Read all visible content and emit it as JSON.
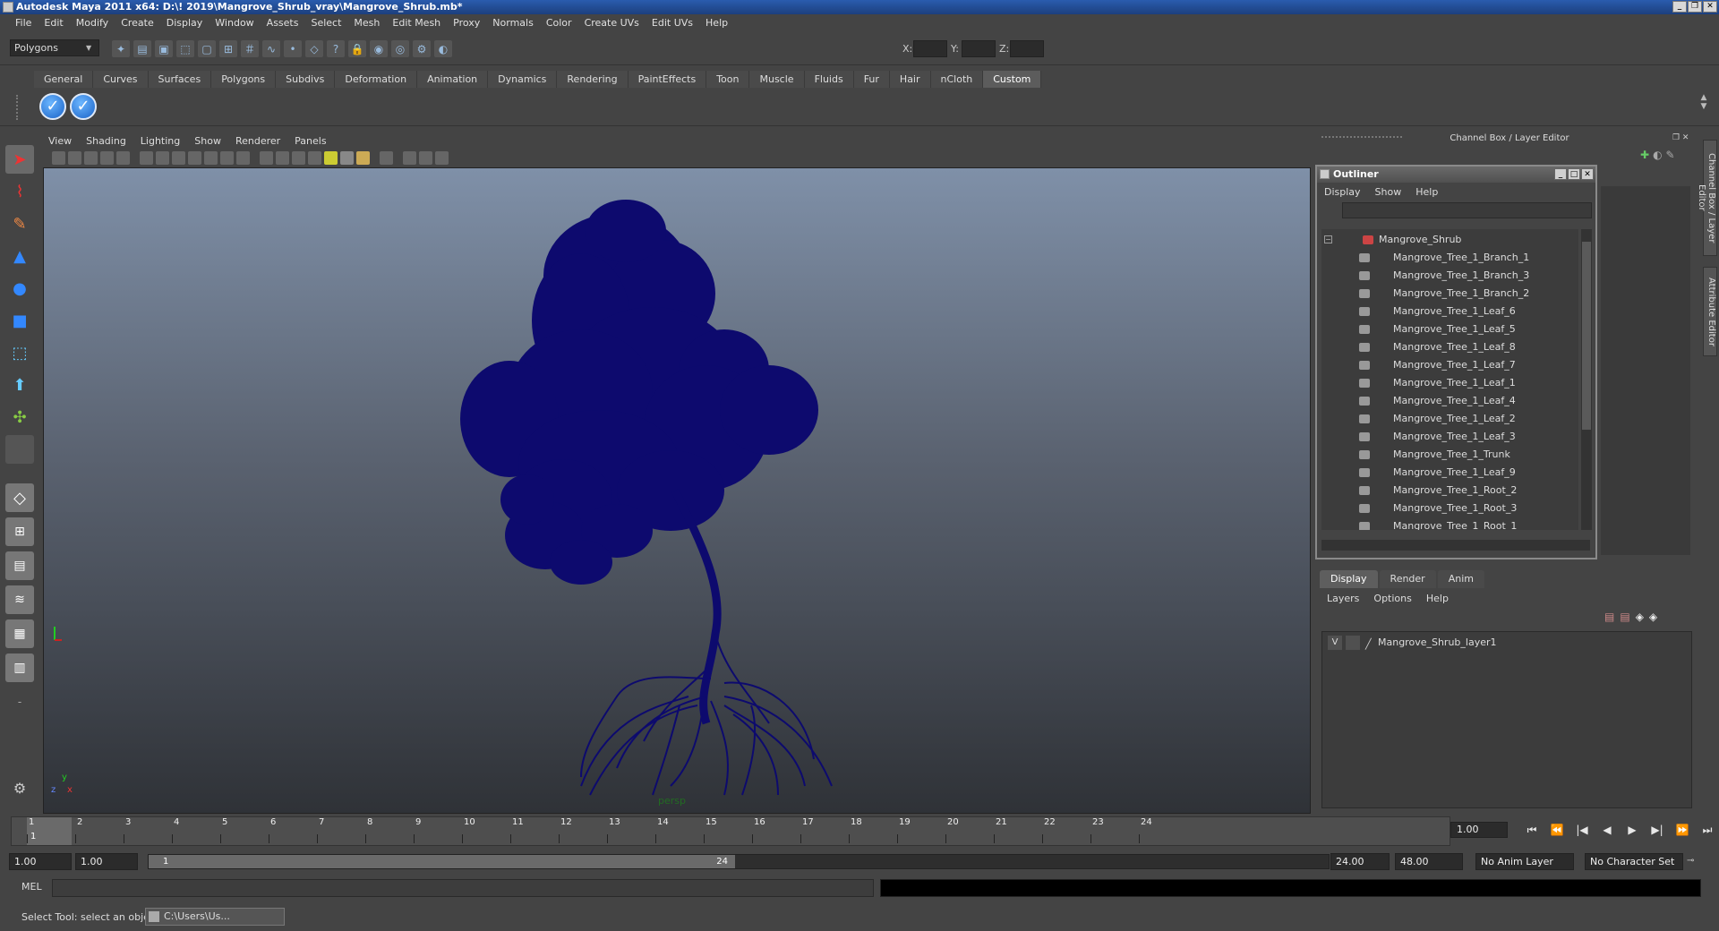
{
  "window": {
    "title": "Autodesk Maya 2011 x64: D:\\! 2019\\Mangrove_Shrub_vray\\Mangrove_Shrub.mb*",
    "buttons": [
      "_",
      "❐",
      "✕"
    ]
  },
  "menubar": [
    "File",
    "Edit",
    "Modify",
    "Create",
    "Display",
    "Window",
    "Assets",
    "Select",
    "Mesh",
    "Edit Mesh",
    "Proxy",
    "Normals",
    "Color",
    "Create UVs",
    "Edit UVs",
    "Help"
  ],
  "statusline": {
    "mode": "Polygons",
    "coords": {
      "x_label": "X:",
      "y_label": "Y:",
      "z_label": "Z:"
    }
  },
  "shelf": {
    "tabs": [
      "General",
      "Curves",
      "Surfaces",
      "Polygons",
      "Subdivs",
      "Deformation",
      "Animation",
      "Dynamics",
      "Rendering",
      "PaintEffects",
      "Toon",
      "Muscle",
      "Fluids",
      "Fur",
      "Hair",
      "nCloth",
      "Custom"
    ],
    "active_tab": "Custom"
  },
  "viewport": {
    "menu": [
      "View",
      "Shading",
      "Lighting",
      "Show",
      "Renderer",
      "Panels"
    ],
    "camera": "persp",
    "axis_y": "y",
    "axis_x": "x",
    "axis_z": "z",
    "colors": {
      "tree": "#0d0a6e",
      "sky_top": "#7f90a8",
      "ground": "#2f3237"
    }
  },
  "right_panel": {
    "title": "Channel Box / Layer Editor",
    "side_tabs": [
      "Channel Box / Layer Editor",
      "Attribute Editor"
    ]
  },
  "outliner": {
    "title": "Outliner",
    "menu": [
      "Display",
      "Show",
      "Help"
    ],
    "root": "Mangrove_Shrub",
    "children": [
      "Mangrove_Tree_1_Branch_1",
      "Mangrove_Tree_1_Branch_3",
      "Mangrove_Tree_1_Branch_2",
      "Mangrove_Tree_1_Leaf_6",
      "Mangrove_Tree_1_Leaf_5",
      "Mangrove_Tree_1_Leaf_8",
      "Mangrove_Tree_1_Leaf_7",
      "Mangrove_Tree_1_Leaf_1",
      "Mangrove_Tree_1_Leaf_4",
      "Mangrove_Tree_1_Leaf_2",
      "Mangrove_Tree_1_Leaf_3",
      "Mangrove_Tree_1_Trunk",
      "Mangrove_Tree_1_Leaf_9",
      "Mangrove_Tree_1_Root_2",
      "Mangrove_Tree_1_Root_3",
      "Mangrove_Tree_1_Root_1"
    ]
  },
  "layer_editor": {
    "tabs": [
      "Display",
      "Render",
      "Anim"
    ],
    "active_tab": "Display",
    "menu": [
      "Layers",
      "Options",
      "Help"
    ],
    "layers": [
      {
        "visible": "V",
        "name": "Mangrove_Shrub_layer1"
      }
    ]
  },
  "timeline": {
    "ticks": [
      "1",
      "2",
      "3",
      "4",
      "5",
      "6",
      "7",
      "8",
      "9",
      "10",
      "11",
      "12",
      "13",
      "14",
      "15",
      "16",
      "17",
      "18",
      "19",
      "20",
      "21",
      "22",
      "23",
      "24"
    ],
    "current_frame": "1.00",
    "current_marker": "1",
    "play_buttons": [
      "⏮",
      "⏪",
      "|◀",
      "◀",
      "▶",
      "▶|",
      "⏩",
      "⏭"
    ]
  },
  "range": {
    "start": "1.00",
    "inner_start": "1.00",
    "slider_start": "1",
    "slider_end": "24",
    "end": "24.00",
    "outer_end": "48.00",
    "anim_layer": "No Anim Layer",
    "char_set": "No Character Set"
  },
  "command": {
    "label": "MEL"
  },
  "help": {
    "text": "Select Tool: select an object",
    "task_item": "C:\\Users\\Us..."
  }
}
